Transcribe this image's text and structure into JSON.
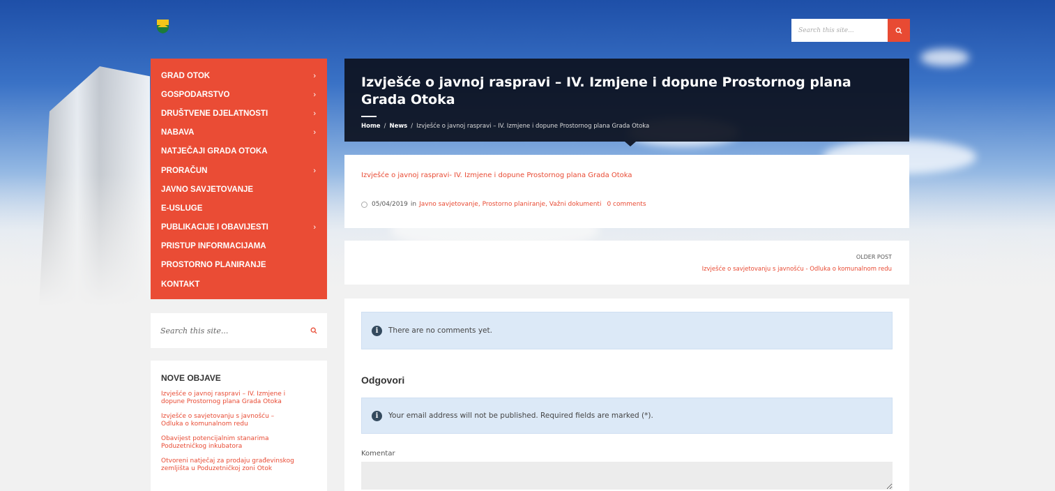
{
  "site": {
    "logo_icon": "coat-of-arms-icon",
    "search_placeholder": "Search this site..."
  },
  "nav": {
    "items": [
      {
        "label": "GRAD OTOK",
        "chevron": "›"
      },
      {
        "label": "GOSPODARSTVO",
        "chevron": "›"
      },
      {
        "label": "DRUŠTVENE DJELATNOSTI",
        "chevron": "›"
      },
      {
        "label": "NABAVA",
        "chevron": "›"
      },
      {
        "label": "NATJEČAJI GRADA OTOKA",
        "chevron": ""
      },
      {
        "label": "PRORAČUN",
        "chevron": "›"
      },
      {
        "label": "JAVNO SAVJETOVANJE",
        "chevron": ""
      },
      {
        "label": "E-USLUGE",
        "chevron": ""
      },
      {
        "label": "PUBLIKACIJE I OBAVIJESTI",
        "chevron": "›"
      },
      {
        "label": "PRISTUP INFORMACIJAMA",
        "chevron": ""
      },
      {
        "label": "PROSTORNO PLANIRANJE",
        "chevron": ""
      },
      {
        "label": "KONTAKT",
        "chevron": ""
      }
    ]
  },
  "sidebar": {
    "search_placeholder": "Search this site...",
    "recent_title": "NOVE OBJAVE",
    "recent_posts": [
      "Izvješće o javnoj raspravi – IV. Izmjene i dopune Prostornog plana Grada Otoka",
      "Izvješće o savjetovanju s javnošću – Odluka o komunalnom redu",
      "Obavijest potencijalnim stanarima Poduzetničkog inkubatora",
      "Otvoreni natječaj za prodaju građevinskog zemljišta u Poduzetničkoj zoni Otok"
    ]
  },
  "hero": {
    "title": "Izvješće o javnoj raspravi – IV. Izmjene i dopune Prostornog plana Grada Otoka",
    "breadcrumb": {
      "home": "Home",
      "sep": "/",
      "news": "News",
      "current": "Izvješće o javnoj raspravi – IV. Izmjene i dopune Prostornog plana Grada Otoka"
    }
  },
  "post": {
    "link": "Izvješće o javnoj raspravi- IV. Izmjene i dopune Prostornog plana Grada Otoka",
    "date": "05/04/2019",
    "in": "in",
    "categories": "Javno savjetovanje, Prostorno planiranje, Važni dokumenti",
    "comments": "0 comments"
  },
  "pager": {
    "label": "OLDER POST",
    "link": "Izvješće o savjetovanju s javnošću - Odluka o komunalnom redu"
  },
  "comments": {
    "none": "There are no comments yet.",
    "reply_title": "Odgovori",
    "email_notice": "Your email address will not be published. Required fields are marked (*).",
    "comment_label": "Komentar"
  },
  "colors": {
    "accent": "#e84a33",
    "hero_bg": "#0d1220",
    "notice_bg": "#dce9f7"
  }
}
